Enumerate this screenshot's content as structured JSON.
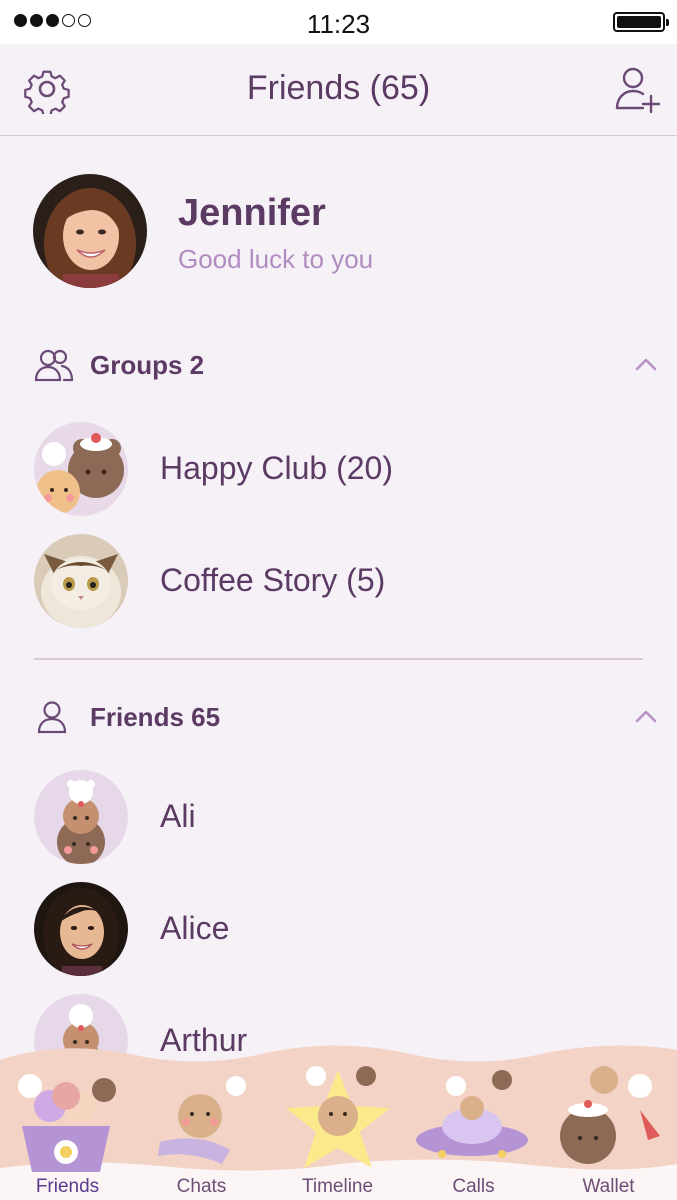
{
  "status_bar": {
    "time": "11:23",
    "signal_bars_filled": 3,
    "signal_bars_total": 5,
    "battery_level": 1.0
  },
  "header": {
    "title": "Friends (65)",
    "settings_icon": "gear-icon",
    "add_friend_icon": "add-user-icon"
  },
  "profile": {
    "name": "Jennifer",
    "status": "Good luck to you"
  },
  "groups_section": {
    "label": "Groups 2",
    "icon": "group-icon",
    "items": [
      {
        "label": "Happy Club (20)"
      },
      {
        "label": "Coffee Story (5)"
      }
    ]
  },
  "friends_section": {
    "label": "Friends 65",
    "icon": "person-icon",
    "items": [
      {
        "label": "Ali"
      },
      {
        "label": "Alice"
      },
      {
        "label": "Arthur"
      }
    ]
  },
  "tabs": [
    {
      "label": "Friends",
      "active": true
    },
    {
      "label": "Chats",
      "active": false
    },
    {
      "label": "Timeline",
      "active": false
    },
    {
      "label": "Calls",
      "active": false
    },
    {
      "label": "Wallet",
      "active": false
    }
  ],
  "colors": {
    "accent": "#5b3a63",
    "muted": "#b08cc1",
    "background": "#f6f1f7"
  }
}
